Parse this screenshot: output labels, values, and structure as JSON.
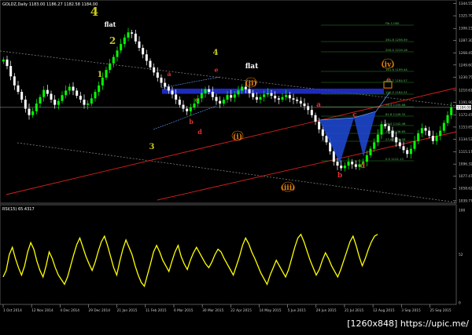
{
  "window": {
    "symbol_line": "GOLDZ,Daily  1183.00 1186.27 1182.58 1184.00",
    "rsi_label": "RSI(15) 65.4317",
    "watermark": "[1260x848] https://upic.me/"
  },
  "colors": {
    "background": "#000000",
    "bull_candle": "#00ff00",
    "bear_candle": "#ffffff",
    "rsi_line": "#ffff00",
    "channel": "#808080",
    "red_line": "#d82020",
    "blue_zone": "#2233dd",
    "wave_green": "#c8c820",
    "wave_white": "#ffffff",
    "wave_orange": "#e08010",
    "wave_red": "#e03030"
  },
  "chart_data": [
    {
      "type": "candlestick",
      "title": "GOLDZ,Daily",
      "ylim": [
        1039.5,
        1344
      ],
      "y_ticks": [
        "1344.55",
        "1325.70",
        "1306.15",
        "1287.30",
        "1268.45",
        "1249.60",
        "1230.75",
        "1210.61",
        "1191.90",
        "1172.47",
        "1153.65",
        "1134.53",
        "1115.17",
        "1096.32",
        "1077.47",
        "1058.62",
        "1039.77"
      ],
      "last_price": "1184.00",
      "x_tick_labels": [
        "1 Oct 2014",
        "12 Nov 2014",
        "4 Dec 2014",
        "29 Dec 2014",
        "21 Jan 2015",
        "11 Feb 2015",
        "6 Mar 2015",
        "30 Mar 2015",
        "22 Apr 2015",
        "14 May 2015",
        "5 Jun 2015",
        "29 Jun 2015",
        "21 Jul 2015",
        "12 Aug 2015",
        "3 Sep 2015",
        "25 Sep 2015"
      ],
      "close_path": [
        1258,
        1248,
        1232,
        1218,
        1208,
        1196,
        1182,
        1172,
        1178,
        1190,
        1200,
        1211,
        1205,
        1196,
        1188,
        1194,
        1203,
        1210,
        1216,
        1210,
        1202,
        1196,
        1188,
        1190,
        1198,
        1208,
        1218,
        1230,
        1242,
        1252,
        1262,
        1272,
        1282,
        1292,
        1300,
        1298,
        1286,
        1276,
        1266,
        1256,
        1246,
        1238,
        1230,
        1222,
        1216,
        1210,
        1204,
        1196,
        1188,
        1182,
        1178,
        1184,
        1190,
        1198,
        1206,
        1212,
        1208,
        1200,
        1194,
        1190,
        1196,
        1203,
        1199,
        1204,
        1210,
        1216,
        1212,
        1206,
        1200,
        1196,
        1200,
        1204,
        1206,
        1202,
        1198,
        1196,
        1200,
        1203,
        1198,
        1196,
        1194,
        1190,
        1186,
        1180,
        1172,
        1162,
        1150,
        1140,
        1130,
        1116,
        1100,
        1094,
        1090,
        1094,
        1100,
        1096,
        1092,
        1096,
        1100,
        1110,
        1120,
        1130,
        1142,
        1158,
        1155,
        1148,
        1138,
        1130,
        1124,
        1118,
        1112,
        1120,
        1132,
        1144,
        1152,
        1148,
        1140,
        1132,
        1140,
        1148,
        1160,
        1172,
        1184
      ],
      "fib_levels": [
        "Fib 1.000",
        "261.8 1256.59",
        "200.0 1219.18",
        "161.8 1199.44",
        "138.2 1184.57",
        "100.0 1164.31",
        "76.4 1155.88",
        "61.8 1149.32",
        "50.0 1142.48",
        "38.2 1136.69",
        "23.6 1130.08",
        "0.0 1121.13"
      ],
      "annotations": [
        {
          "text": "4",
          "color": "wave_green"
        },
        {
          "text": "flat",
          "color": "wave_white"
        },
        {
          "text": "2",
          "color": "wave_green"
        },
        {
          "text": "1",
          "color": "wave_green"
        },
        {
          "text": "3",
          "color": "wave_green"
        },
        {
          "text": "4",
          "color": "wave_green"
        },
        {
          "text": "flat",
          "color": "wave_white"
        },
        {
          "text": "a",
          "color": "wave_red"
        },
        {
          "text": "c",
          "color": "wave_red"
        },
        {
          "text": "e",
          "color": "wave_red"
        },
        {
          "text": "b",
          "color": "wave_red"
        },
        {
          "text": "d",
          "color": "wave_red"
        },
        {
          "text": "(ii)",
          "color": "wave_orange"
        },
        {
          "text": "(i)",
          "color": "wave_orange"
        },
        {
          "text": "(iii)",
          "color": "wave_orange"
        },
        {
          "text": "(iv)",
          "color": "wave_orange"
        },
        {
          "text": "e",
          "color": "wave_red"
        },
        {
          "text": "a",
          "color": "wave_red"
        },
        {
          "text": "c",
          "color": "wave_red"
        },
        {
          "text": "b",
          "color": "wave_red"
        },
        {
          "text": "d",
          "color": "wave_red"
        }
      ]
    },
    {
      "type": "line",
      "title": "RSI(15) 65.4317",
      "ylim": [
        0,
        100
      ],
      "y_ticks": [
        "100",
        "52",
        "0"
      ],
      "values": [
        28,
        35,
        52,
        60,
        48,
        38,
        30,
        40,
        55,
        65,
        58,
        45,
        35,
        28,
        40,
        55,
        48,
        38,
        30,
        25,
        20,
        28,
        40,
        52,
        63,
        70,
        60,
        50,
        42,
        35,
        44,
        56,
        66,
        72,
        62,
        50,
        38,
        30,
        45,
        58,
        68,
        60,
        52,
        40,
        30,
        22,
        18,
        30,
        42,
        55,
        62,
        55,
        46,
        40,
        34,
        45,
        55,
        62,
        50,
        42,
        36,
        46,
        54,
        60,
        54,
        48,
        42,
        38,
        44,
        52,
        58,
        55,
        48,
        42,
        36,
        30,
        40,
        50,
        62,
        70,
        64,
        55,
        48,
        40,
        32,
        26,
        20,
        30,
        38,
        46,
        40,
        34,
        28,
        36,
        48,
        60,
        70,
        74,
        66,
        56,
        46,
        38,
        30,
        36,
        46,
        54,
        48,
        40,
        34,
        28,
        36,
        46,
        56,
        66,
        72,
        62,
        50,
        40,
        48,
        58,
        66,
        72,
        74
      ]
    }
  ]
}
